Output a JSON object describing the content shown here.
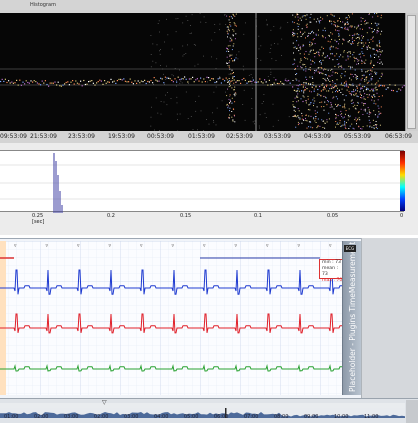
{
  "top_panel": {
    "title": "Histogram",
    "time_ticks": [
      "09:53:09",
      "21:53:09",
      "23:53:09",
      "19:53:09",
      "00:53:09",
      "01:53:09",
      "02:53:09",
      "03:53:09",
      "04:53:09",
      "05:53:09",
      "06:53:09"
    ]
  },
  "histogram": {
    "x_ticks": [
      "0.25",
      "0.2",
      "0.15",
      "0.1",
      "0.05",
      "0"
    ],
    "x_unit": "[sec]"
  },
  "ecg": {
    "info": {
      "line1": "min : 73",
      "line2": "mean : 73",
      "line3": "max : 70"
    },
    "badge": "ECG",
    "side_label": "Placeholder - Plugins TimeMeasurements",
    "colors": {
      "blue": "#1f3bd0",
      "red": "#e0202a",
      "green": "#2aa232"
    }
  },
  "timeline": {
    "ticks": [
      "01:00",
      "02:00",
      "03:00",
      "02:00",
      "03:00",
      "04:00",
      "05:00",
      "06:00",
      "07:00",
      "08:00",
      "09:00",
      "10:00",
      "11:00"
    ]
  }
}
